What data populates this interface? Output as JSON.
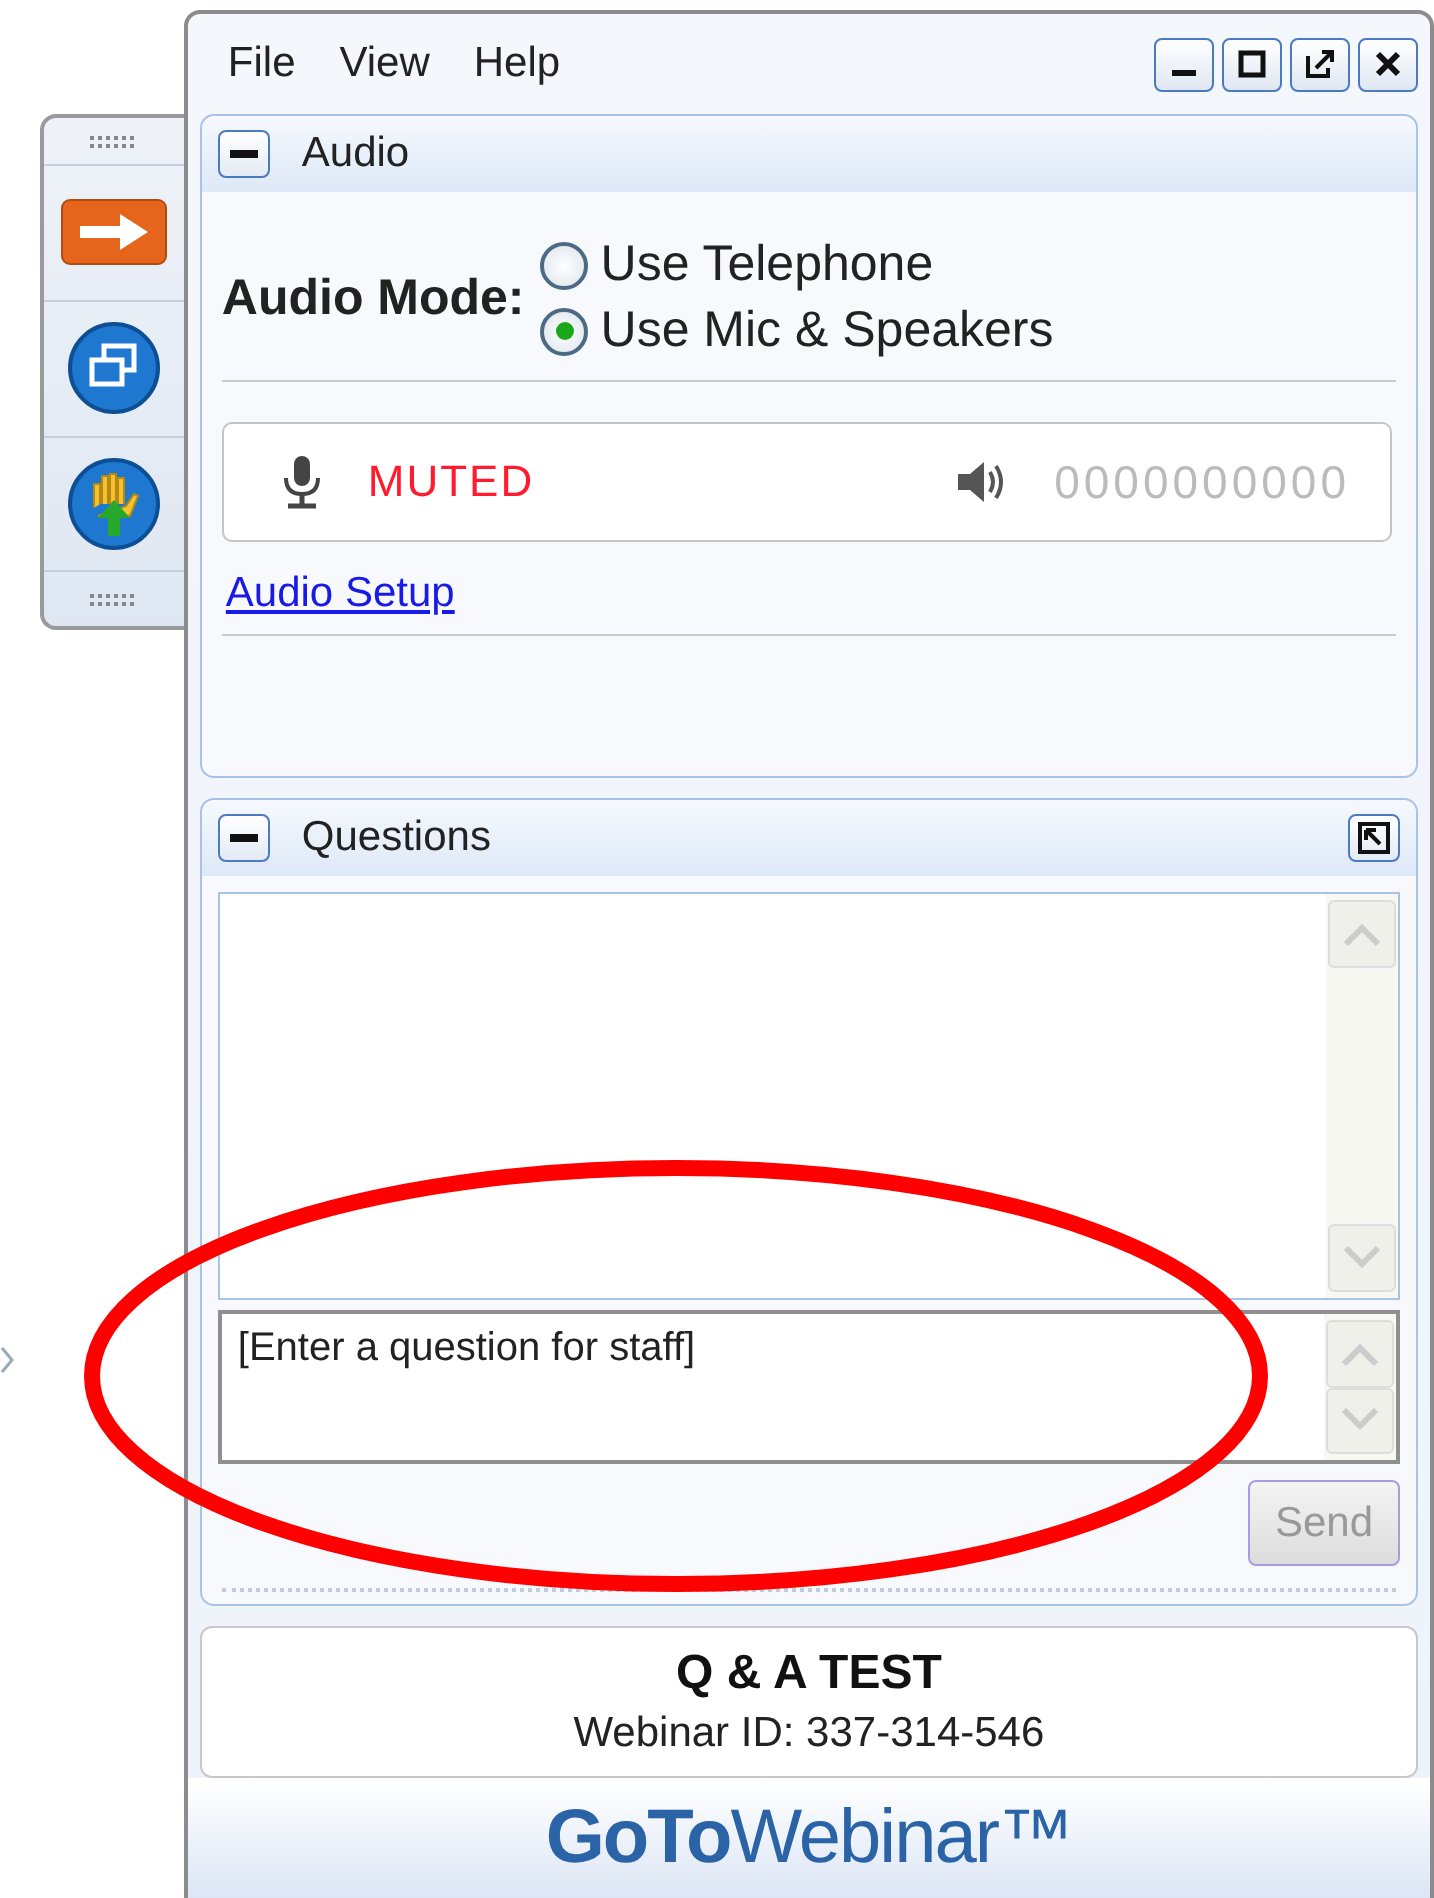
{
  "menu": [
    {
      "label": "File"
    },
    {
      "label": "View"
    },
    {
      "label": "Help"
    }
  ],
  "audio": {
    "title": "Audio",
    "mode_label": "Audio Mode:",
    "options": [
      {
        "label": "Use Telephone",
        "selected": false
      },
      {
        "label": "Use Mic & Speakers",
        "selected": true
      }
    ],
    "mic_status": "MUTED",
    "speaker_reading": "0000000000",
    "setup_link": "Audio Setup"
  },
  "questions": {
    "title": "Questions",
    "placeholder": "[Enter a question for staff]",
    "send": {
      "label": "Send",
      "disabled": true
    }
  },
  "webinar": {
    "title": "Q & A TEST",
    "id_line": "Webinar ID: 337-314-546"
  },
  "brand": "**GoTo**Webinar™",
  "annotation": {
    "kind": "ellipse"
  }
}
